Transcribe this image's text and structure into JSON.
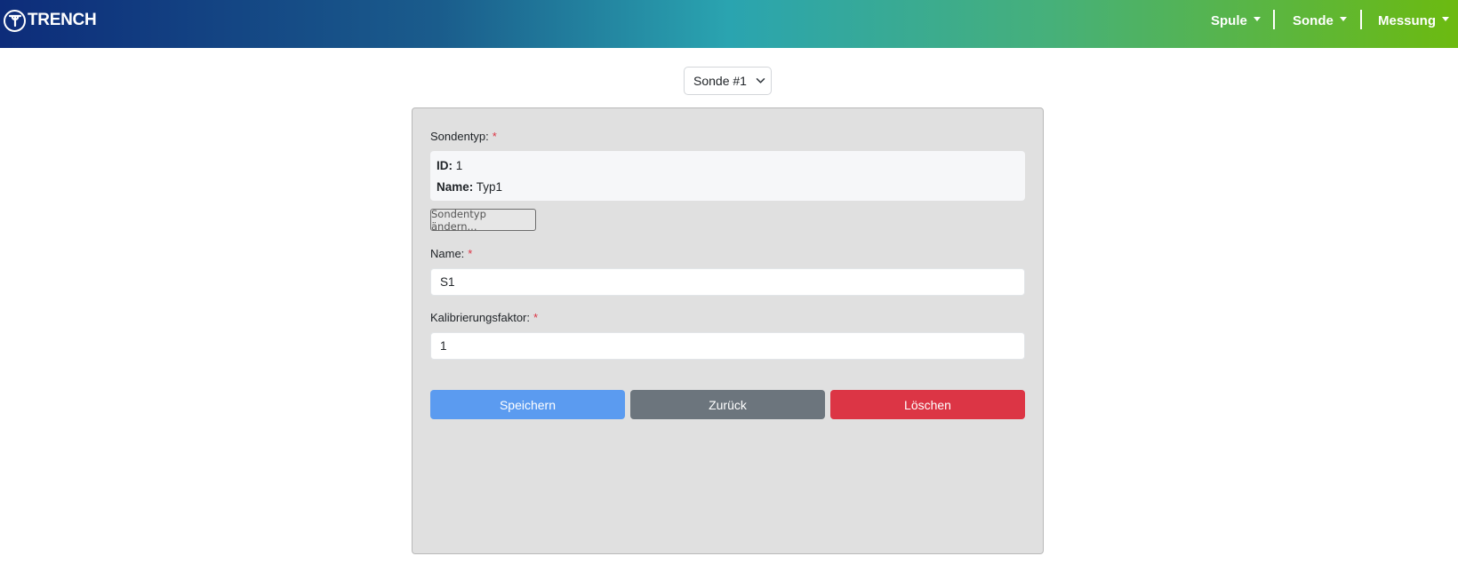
{
  "brand": {
    "name": "TRENCH"
  },
  "nav": {
    "items": [
      {
        "label": "Spule"
      },
      {
        "label": "Sonde"
      },
      {
        "label": "Messung"
      }
    ]
  },
  "probe_select": {
    "value": "Sonde #1"
  },
  "form": {
    "probe_type": {
      "label": "Sondentyp:",
      "required_mark": "*",
      "id_label": "ID:",
      "id_value": "1",
      "name_label": "Name:",
      "name_value": "Typ1",
      "change_button": "Sondentyp ändern..."
    },
    "name": {
      "label": "Name:",
      "required_mark": "*",
      "value": "S1"
    },
    "calibration": {
      "label": "Kalibrierungsfaktor:",
      "required_mark": "*",
      "value": "1"
    },
    "buttons": {
      "save": "Speichern",
      "back": "Zurück",
      "delete": "Löschen"
    }
  },
  "colors": {
    "save": "#5b9bf0",
    "back": "#6c757d",
    "delete": "#dc3545",
    "required": "#dc3545",
    "panel": "#e0e0e0"
  },
  "icons": [
    "trench-logo-icon",
    "chevron-down-icon",
    "caret-down-icon"
  ]
}
